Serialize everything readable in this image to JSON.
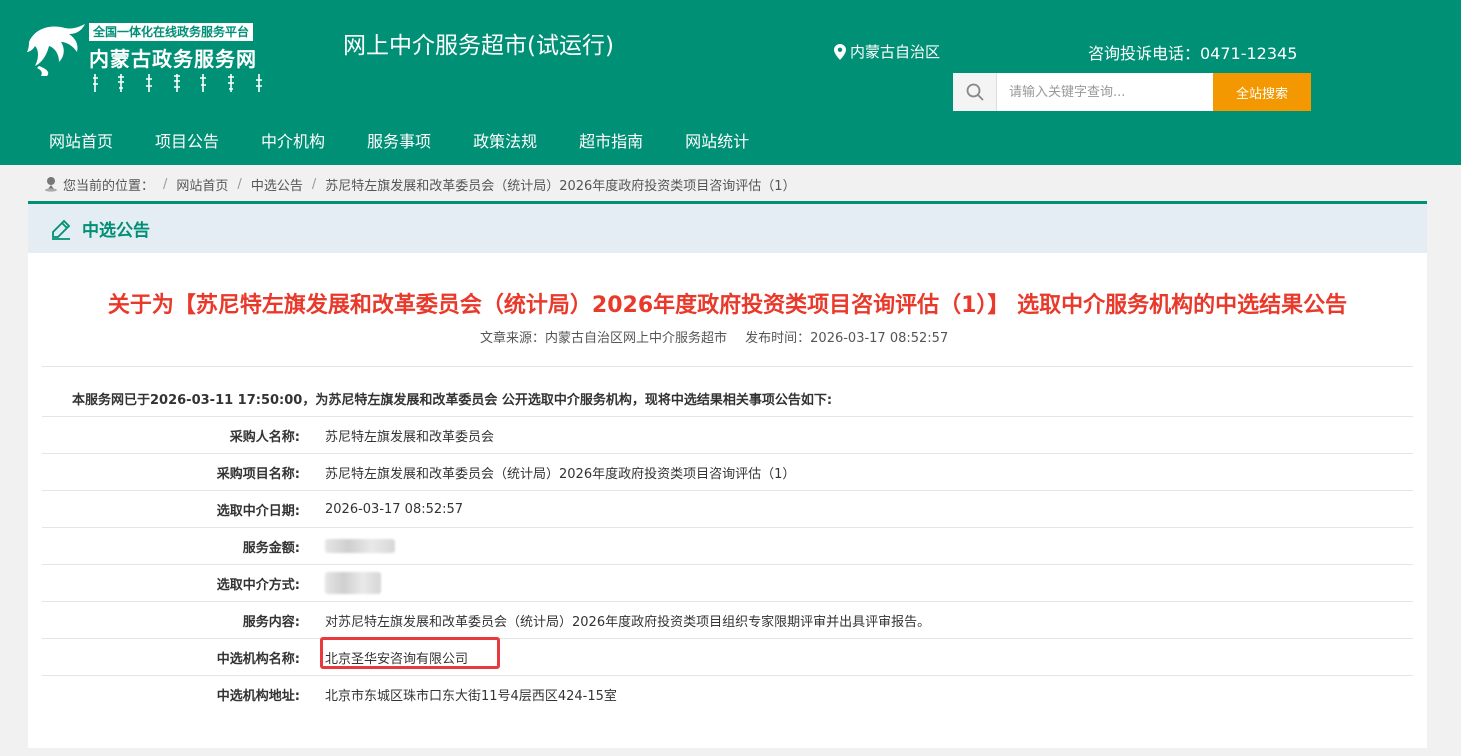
{
  "header": {
    "tagline": "全国一体化在线政务服务平台",
    "portal_name": "内蒙古政务服务网",
    "site_title": "网上中介服务超市(试运行)",
    "region": "内蒙古自治区",
    "hotline": "咨询投诉电话：0471-12345",
    "search_placeholder": "请输入关键字查询...",
    "search_button": "全站搜索",
    "brand_color": "#009076",
    "accent_color": "#f39800"
  },
  "nav": [
    "网站首页",
    "项目公告",
    "中介机构",
    "服务事项",
    "政策法规",
    "超市指南",
    "网站统计"
  ],
  "breadcrumb": {
    "label": "您当前的位置：",
    "items": [
      "网站首页",
      "中选公告",
      "苏尼特左旗发展和改革委员会（统计局）2026年度政府投资类项目咨询评估（1）"
    ]
  },
  "section_title": "中选公告",
  "notice": {
    "title": "关于为【苏尼特左旗发展和改革委员会（统计局）2026年度政府投资类项目咨询评估（1）】 选取中介服务机构的中选结果公告",
    "source": "文章来源：内蒙古自治区网上中介服务超市",
    "published": "发布时间：2026-03-17 08:52:57",
    "intro": "本服务网已于2026-03-11 17:50:00，为苏尼特左旗发展和改革委员会 公开选取中介服务机构，现将中选结果相关事项公告如下:",
    "title_color": "#e8392b"
  },
  "details": [
    {
      "label": "采购人名称:",
      "value": "苏尼特左旗发展和改革委员会"
    },
    {
      "label": "采购项目名称:",
      "value": "苏尼特左旗发展和改革委员会（统计局）2026年度政府投资类项目咨询评估（1）"
    },
    {
      "label": "选取中介日期:",
      "value": "2026-03-17 08:52:57"
    },
    {
      "label": "服务金额:",
      "value": ""
    },
    {
      "label": "选取中介方式:",
      "value": ""
    },
    {
      "label": "服务内容:",
      "value": "对苏尼特左旗发展和改革委员会（统计局）2026年度政府投资类项目组织专家限期评审并出具评审报告。"
    },
    {
      "label": "中选机构名称:",
      "value": "北京圣华安咨询有限公司"
    },
    {
      "label": "中选机构地址:",
      "value": "北京市东城区珠市口东大街11号4层西区424-15室"
    }
  ]
}
